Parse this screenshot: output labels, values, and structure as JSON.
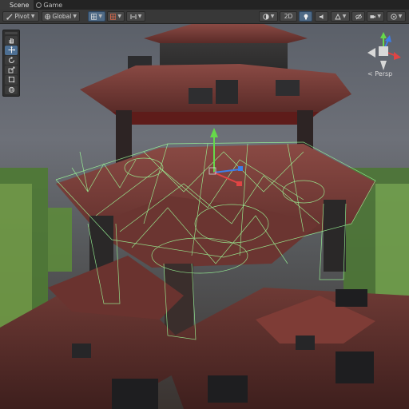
{
  "tabs": [
    {
      "label": "Scene",
      "icon": "scene-icon",
      "active": true
    },
    {
      "label": "Game",
      "icon": "game-icon",
      "active": false
    }
  ],
  "toolbar": {
    "pivot_label": "Pivot",
    "global_label": "Global",
    "mode_2d_label": "2D"
  },
  "palette": {
    "tools": [
      "hand-icon",
      "move-icon",
      "rotate-icon",
      "scale-icon",
      "rect-icon",
      "transform-icon"
    ],
    "selected_index": 1
  },
  "gizmo": {
    "projection_label": "Persp",
    "axis_colors": {
      "x": "#e04444",
      "y": "#66d84a",
      "z": "#3d7ee8"
    }
  },
  "colors": {
    "accent": "#4f6a86",
    "wireframe": "#9eff9a",
    "roof": "#7a3a36"
  }
}
